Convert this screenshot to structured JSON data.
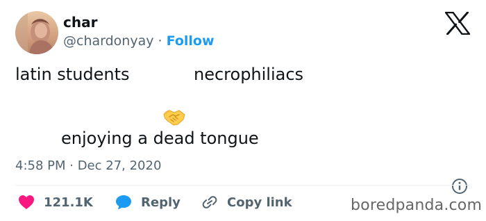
{
  "author": {
    "display_name": "char",
    "handle": "@chardonyay",
    "separator": "·",
    "follow_label": "Follow"
  },
  "tweet": {
    "left_label": "latin students",
    "right_label": "necrophiliacs",
    "center_emoji": "handshake-icon",
    "caption": "enjoying a dead tongue",
    "timestamp": "4:58 PM · Dec 27, 2020"
  },
  "actions": {
    "like_count": "121.1K",
    "reply_label": "Reply",
    "copy_label": "Copy link"
  },
  "watermark": "boredpanda.com",
  "colors": {
    "follow": "#1d9bf0",
    "like": "#f91880",
    "reply": "#1d9bf0",
    "muted": "#536471"
  }
}
